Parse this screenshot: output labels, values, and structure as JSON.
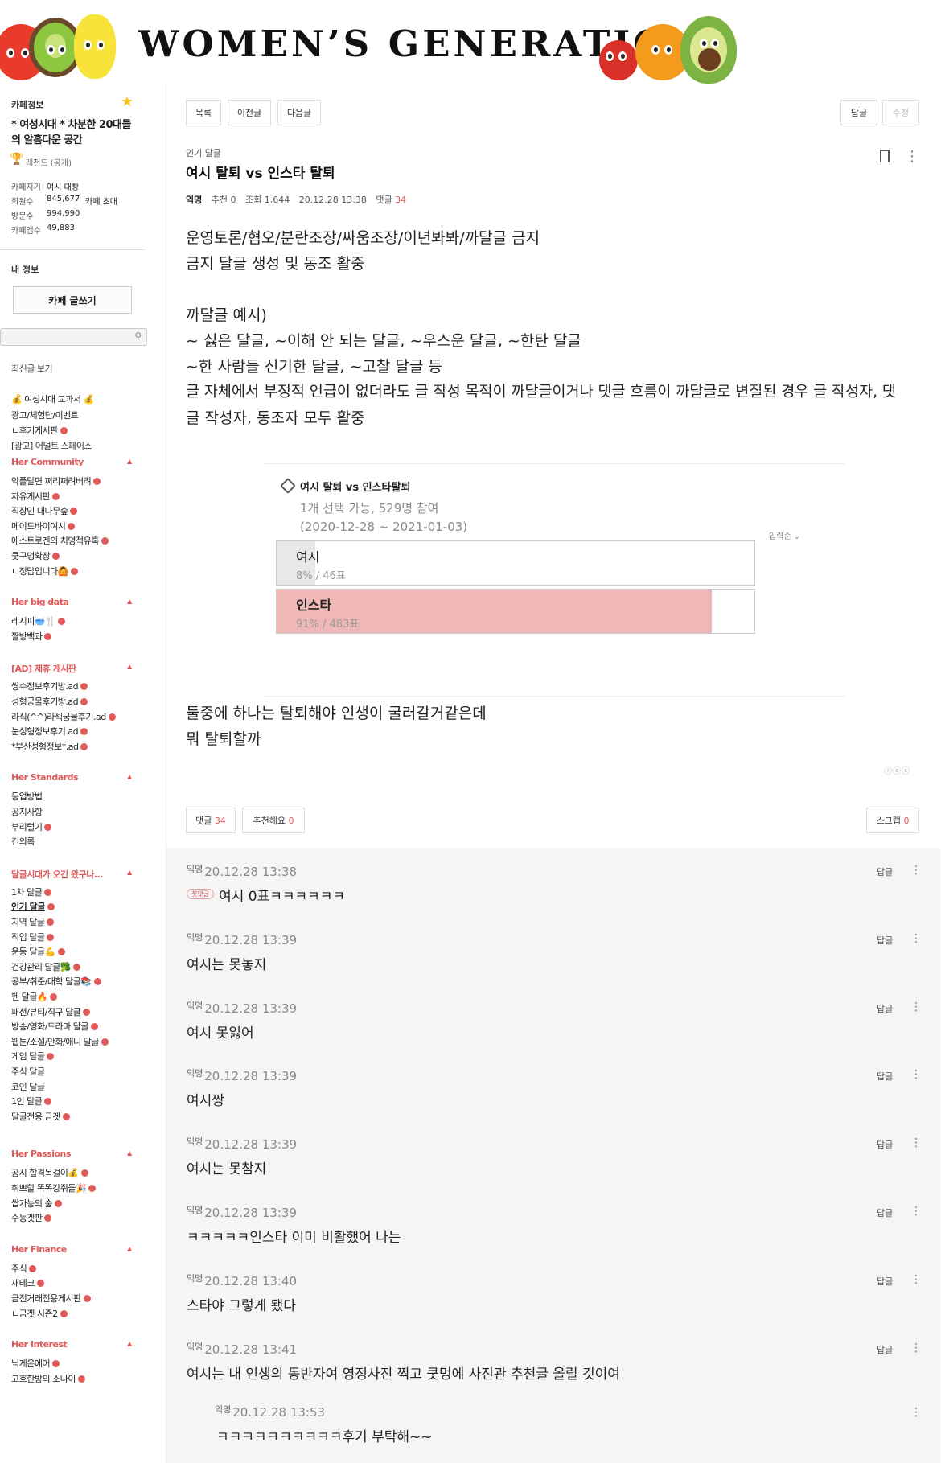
{
  "banner": {
    "title": "WOMEN’S GENERATION"
  },
  "sidebar": {
    "cafe_info_label": "카페정보",
    "cafe_desc": "* 여성시대 * 차분한 20대들의 알흠다운 공간",
    "rank_label": "레전드 (공개)",
    "stats": [
      {
        "label": "카페지기",
        "value": "여시 대빵",
        "extra": ""
      },
      {
        "label": "회원수",
        "value": "845,677",
        "extra": "카페 초대"
      },
      {
        "label": "방문수",
        "value": "994,990",
        "extra": ""
      },
      {
        "label": "카페앱수",
        "value": "49,883",
        "extra": ""
      }
    ],
    "my_info_label": "내 정보",
    "write_button": "카페 글쓰기",
    "recent_posts": "최신글 보기",
    "menu": [
      {
        "text": "💰 여성시대 교과서 💰",
        "dot": false
      },
      {
        "text": "광고/체험단/이벤트",
        "dot": false
      },
      {
        "text": "ㄴ후기게시판",
        "dot": true
      },
      {
        "text": "[광고] 어덜트 스페이스",
        "dot": false
      }
    ],
    "sections": [
      {
        "title": "Her Community",
        "items": [
          {
            "text": "악플달면 쩌리쩌려버려",
            "dot": true
          },
          {
            "text": "자유게시판",
            "dot": true
          },
          {
            "text": "직장인 대나무숲",
            "dot": true
          },
          {
            "text": "메이드바이여시",
            "dot": true
          },
          {
            "text": "에스트로겐의 치명적유혹",
            "dot": true
          },
          {
            "text": "쿳구멍확장",
            "dot": true
          },
          {
            "text": "ㄴ정답입니다🙆",
            "dot": true
          }
        ]
      },
      {
        "title": "Her big data",
        "items": [
          {
            "text": "레시피🥣🍴",
            "dot": true
          },
          {
            "text": "짤방백과",
            "dot": true
          }
        ]
      },
      {
        "title": "[AD] 제휴 게시판",
        "items": [
          {
            "text": "쌍수정보후기방.ad",
            "dot": true
          },
          {
            "text": "성형궁물후기방.ad",
            "dot": true
          },
          {
            "text": "라식(^^)라섹궁물후기.ad",
            "dot": true
          },
          {
            "text": "눈성형정보후기.ad",
            "dot": true
          },
          {
            "text": "*부산성형정보*.ad",
            "dot": true
          }
        ]
      },
      {
        "title": "Her Standards",
        "items": [
          {
            "text": "등업방법",
            "dot": false
          },
          {
            "text": "공지사항",
            "dot": false
          },
          {
            "text": "부리털기",
            "dot": true
          },
          {
            "text": "건의록",
            "dot": false
          }
        ]
      },
      {
        "title": "달글시대가 오긴 왔구나...",
        "items": [
          {
            "text": "1차 달글",
            "dot": true
          },
          {
            "text": "인기 달글",
            "dot": true
          },
          {
            "text": "지역 달글",
            "dot": true
          },
          {
            "text": "직업 달글",
            "dot": true
          },
          {
            "text": "운동 달글💪",
            "dot": true
          },
          {
            "text": "건강관리 달글🥦",
            "dot": true
          },
          {
            "text": "공부/취준/대학 달글📚",
            "dot": true
          },
          {
            "text": "펜 달글🔥",
            "dot": true
          },
          {
            "text": "패션/뷰티/직구 달글",
            "dot": true
          },
          {
            "text": "방송/영화/드라마 달글",
            "dot": true
          },
          {
            "text": "웹툰/소설/만화/애니 달글",
            "dot": true
          },
          {
            "text": "게임 달글",
            "dot": true
          },
          {
            "text": "주식 달글",
            "dot": false
          },
          {
            "text": "코인 달글",
            "dot": false
          },
          {
            "text": "1인 달글",
            "dot": true
          },
          {
            "text": "달글전용 금겟",
            "dot": true
          }
        ]
      },
      {
        "title": "Her Passions",
        "items": [
          {
            "text": "공시 합격목걸이💰",
            "dot": true
          },
          {
            "text": "취뽀할 똑똑강쥐들🎉",
            "dot": true
          },
          {
            "text": "쌉가능의 숲",
            "dot": true
          },
          {
            "text": "수능겟판",
            "dot": true
          }
        ]
      },
      {
        "title": "Her Finance",
        "items": [
          {
            "text": "주식",
            "dot": true
          },
          {
            "text": "재테크",
            "dot": true
          },
          {
            "text": "금전거래전용게시판",
            "dot": true
          },
          {
            "text": "ㄴ금겟 시즌2",
            "dot": true
          }
        ]
      },
      {
        "title": "Her Interest",
        "items": [
          {
            "text": "닉게온에어",
            "dot": true
          },
          {
            "text": "고흐한방의 소나이",
            "dot": true
          }
        ]
      }
    ]
  },
  "toolbar": {
    "list": "목록",
    "prev": "이전글",
    "next": "다음글",
    "reply": "답글",
    "edit": "수정"
  },
  "post": {
    "board": "인기 달글",
    "title": "여시 탈퇴 vs 인스타 탈퇴",
    "author": "익명",
    "recommend": "추천 0",
    "views": "조회 1,644",
    "date": "20.12.28 13:38",
    "comment_label": "댓글",
    "comment_count": "34",
    "body_top": [
      "운영토론/혐오/분란조장/싸움조장/이년봐봐/까달글 금지",
      "금지 달글 생성 및 동조 활중",
      "",
      "까달글 예시)",
      "~ 싫은 달글, ~이해 안 되는 달글, ~우스운 달글, ~한탄 달글",
      "~한 사람들 신기한 달글, ~고찰 달글 등",
      "글 자체에서 부정적 언급이 없더라도 글 작성 목적이 까달글이거나 댓글 흐름이 까달글로 변질된 경우 글 작성자, 댓",
      "글 작성자, 동조자 모두 활중"
    ],
    "body_bottom": [
      "둘중에 하나는 탈퇴해야 인생이 굴러갈거같은데",
      "뭐 탈퇴할까"
    ]
  },
  "poll": {
    "title": "여시 탈퇴 vs 인스타탈퇴",
    "subtitle": "1개 선택 가능, 529명 참여",
    "period": "(2020-12-28 ~ 2021-01-03)",
    "sort": "입력순",
    "options": [
      {
        "label": "여시",
        "stats": "8% / 46표",
        "percent": 8,
        "bold": false,
        "color": "#e8e8e8"
      },
      {
        "label": "인스타",
        "stats": "91% / 483표",
        "percent": 91,
        "bold": true,
        "color": "#f0b7b7"
      }
    ]
  },
  "actions": {
    "comments_label": "댓글",
    "comments_count": "34",
    "recommend_label": "추천해요",
    "recommend_count": "0",
    "scrap_label": "스크랩",
    "scrap_count": "0"
  },
  "comments": [
    {
      "author": "익명",
      "date": "20.12.28 13:38",
      "badge": "첫댓글",
      "text": "여시 0표ㅋㅋㅋㅋㅋㅋ",
      "reply": "답글"
    },
    {
      "author": "익명",
      "date": "20.12.28 13:39",
      "badge": "",
      "text": "여시는 못놓지",
      "reply": "답글"
    },
    {
      "author": "익명",
      "date": "20.12.28 13:39",
      "badge": "",
      "text": "여시 못잃어",
      "reply": "답글"
    },
    {
      "author": "익명",
      "date": "20.12.28 13:39",
      "badge": "",
      "text": "여시짱",
      "reply": "답글"
    },
    {
      "author": "익명",
      "date": "20.12.28 13:39",
      "badge": "",
      "text": "여시는 못참지",
      "reply": "답글"
    },
    {
      "author": "익명",
      "date": "20.12.28 13:39",
      "badge": "",
      "text": "ㅋㅋㅋㅋㅋ인스타 이미 비활했어 나는",
      "reply": "답글"
    },
    {
      "author": "익명",
      "date": "20.12.28 13:40",
      "badge": "",
      "text": "스타야 그렇게 됐다",
      "reply": "답글"
    },
    {
      "author": "익명",
      "date": "20.12.28 13:41",
      "badge": "",
      "text": "여시는 내 인생의 동반자여 영정사진 찍고 쿳멍에 사진관 추천글 올릴 것이여",
      "reply": "답글"
    }
  ],
  "nested_comment": {
    "author": "익명",
    "date": "20.12.28 13:53",
    "text": "ㅋㅋㅋㅋㅋㅋㅋㅋㅋㅋ후기 부탁해~~"
  },
  "colors": {
    "accent": "#e05a5a",
    "poll_win": "#f0b7b7",
    "poll_lose": "#e8e8e8",
    "comment_bg": "#f5f5f5"
  }
}
